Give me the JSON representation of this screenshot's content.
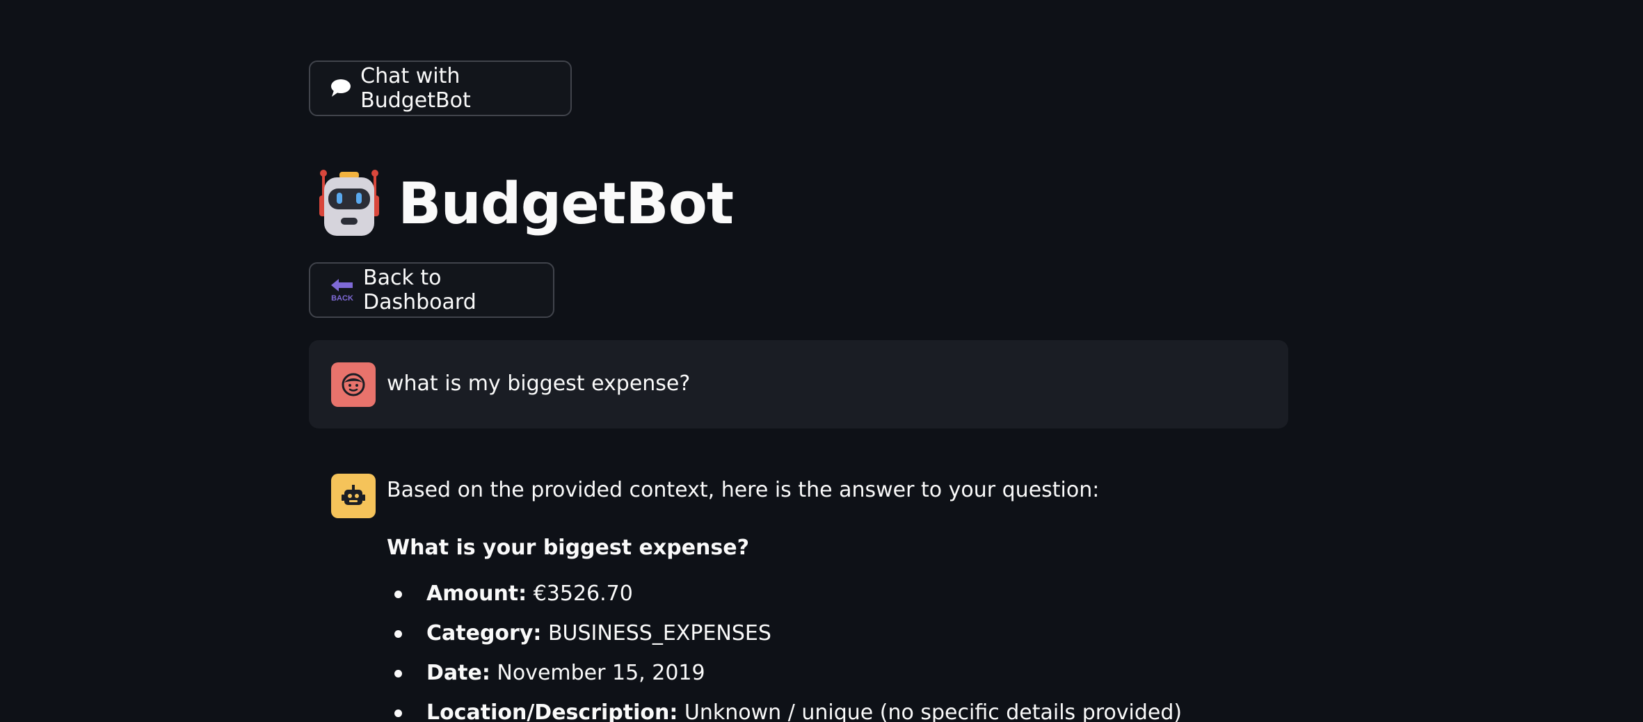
{
  "buttons": {
    "chat_label": "Chat with BudgetBot",
    "chat_icon": "speech-balloon-icon",
    "back_label": "Back to Dashboard",
    "back_icon": "back-arrow-icon"
  },
  "header": {
    "title": "BudgetBot",
    "icon": "robot-icon"
  },
  "messages": {
    "user": {
      "avatar": "user-face-icon",
      "text": "what is my biggest expense?"
    },
    "assistant": {
      "avatar": "bot-icon",
      "intro": "Based on the provided context, here is the answer to your question:",
      "heading": "What is your biggest expense?",
      "items": [
        {
          "label": "Amount:",
          "value": "€3526.70"
        },
        {
          "label": "Category:",
          "value": "BUSINESS_EXPENSES"
        },
        {
          "label": "Date:",
          "value": "November 15, 2019"
        },
        {
          "label": "Location/Description:",
          "value": "Unknown / unique (no specific details provided)"
        }
      ]
    }
  },
  "colors": {
    "background": "#0e1117",
    "user_bubble": "#1a1d24",
    "user_avatar": "#e8736c",
    "bot_avatar": "#f5c35a",
    "text": "#fafafa"
  }
}
